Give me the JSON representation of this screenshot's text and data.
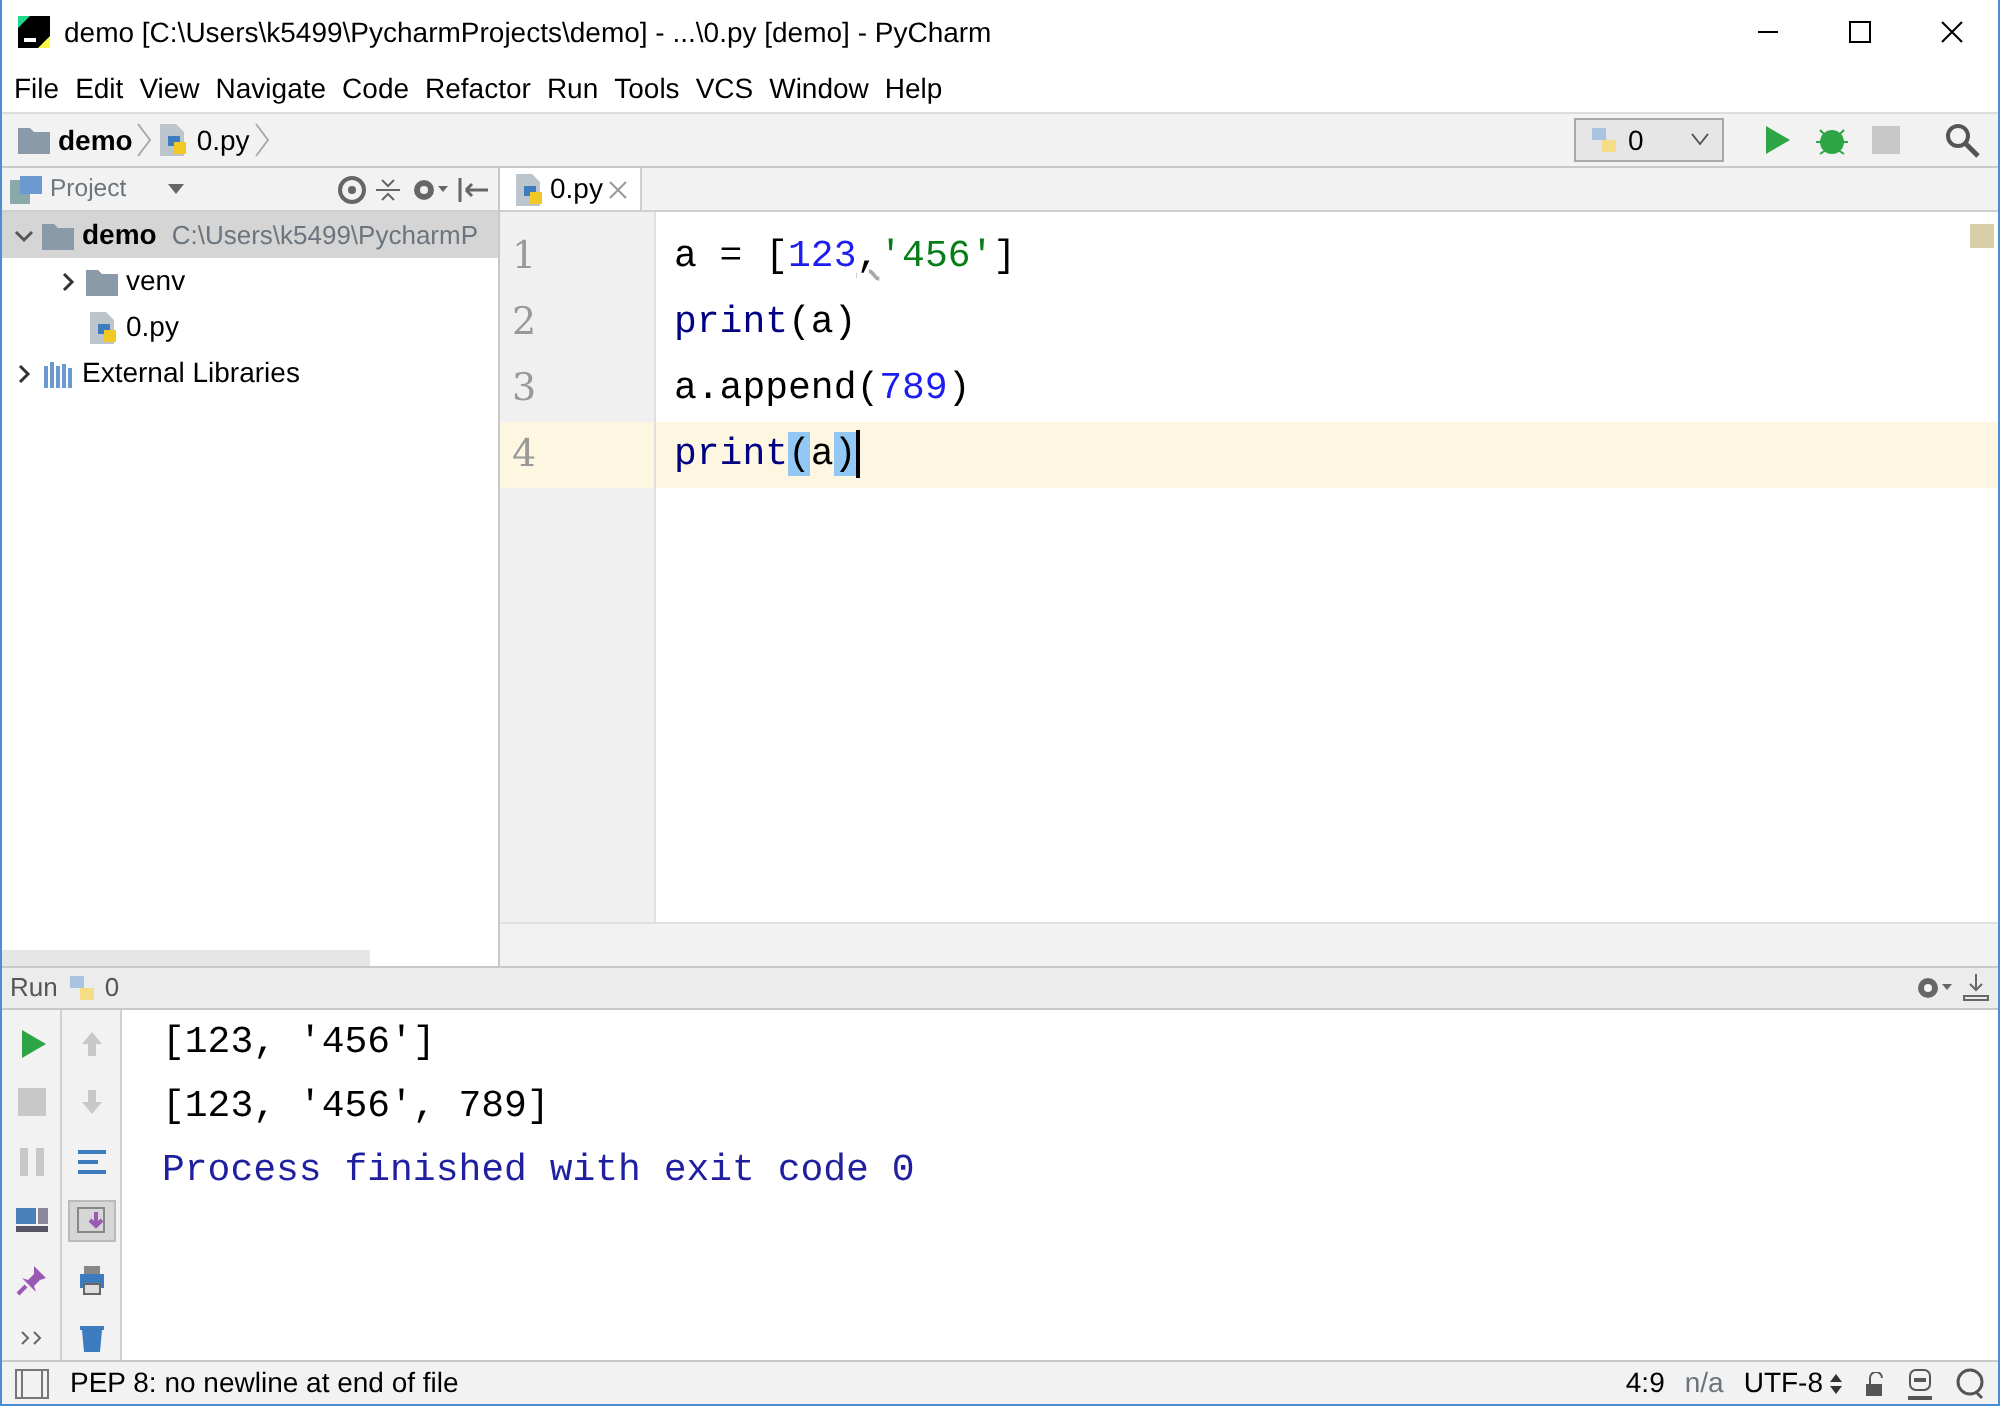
{
  "window": {
    "title": "demo [C:\\Users\\k5499\\PycharmProjects\\demo] - ...\\0.py [demo] - PyCharm"
  },
  "menu": [
    "File",
    "Edit",
    "View",
    "Navigate",
    "Code",
    "Refactor",
    "Run",
    "Tools",
    "VCS",
    "Window",
    "Help"
  ],
  "breadcrumb": [
    {
      "label": "demo",
      "kind": "folder"
    },
    {
      "label": "0.py",
      "kind": "file"
    }
  ],
  "run_config": {
    "label": "0"
  },
  "project_panel": {
    "title": "Project",
    "tree": [
      {
        "label": "demo",
        "path": "C:\\Users\\k5499\\PycharmP",
        "kind": "folder",
        "expanded": true,
        "selected": true,
        "children": [
          {
            "label": "venv",
            "kind": "folder",
            "expanded": false,
            "selected": false
          },
          {
            "label": "0.py",
            "kind": "file",
            "selected": false
          }
        ]
      },
      {
        "label": "External Libraries",
        "kind": "libraries",
        "expanded": false,
        "selected": false
      }
    ]
  },
  "editor": {
    "tabs": [
      {
        "label": "0.py",
        "selected": true
      }
    ],
    "lines": [
      {
        "number": "1",
        "current": false,
        "tokens": [
          {
            "text": "a = [",
            "kind": "plain"
          },
          {
            "text": "123",
            "kind": "number"
          },
          {
            "text": ",",
            "kind": "warning"
          },
          {
            "text": "'456'",
            "kind": "string"
          },
          {
            "text": "]",
            "kind": "plain"
          }
        ]
      },
      {
        "number": "2",
        "current": false,
        "tokens": [
          {
            "text": "print",
            "kind": "builtin"
          },
          {
            "text": "(a)",
            "kind": "plain"
          }
        ]
      },
      {
        "number": "3",
        "current": false,
        "tokens": [
          {
            "text": "a.append(",
            "kind": "plain"
          },
          {
            "text": "789",
            "kind": "number"
          },
          {
            "text": ")",
            "kind": "plain"
          }
        ]
      },
      {
        "number": "4",
        "current": true,
        "tokens": [
          {
            "text": "print",
            "kind": "builtin"
          },
          {
            "text": "(",
            "kind": "match"
          },
          {
            "text": "a",
            "kind": "plain"
          },
          {
            "text": ")",
            "kind": "match"
          }
        ]
      }
    ]
  },
  "run_panel": {
    "title": "Run",
    "config": "0",
    "output": [
      {
        "text": "[123, '456']",
        "kind": "stdout"
      },
      {
        "text": "[123, '456', 789]",
        "kind": "stdout"
      },
      {
        "text": "Process finished with exit code 0",
        "kind": "system"
      }
    ]
  },
  "status_bar": {
    "message": "PEP 8: no newline at end of file",
    "position": "4:9",
    "indent": "n/a",
    "encoding": "UTF-8"
  }
}
